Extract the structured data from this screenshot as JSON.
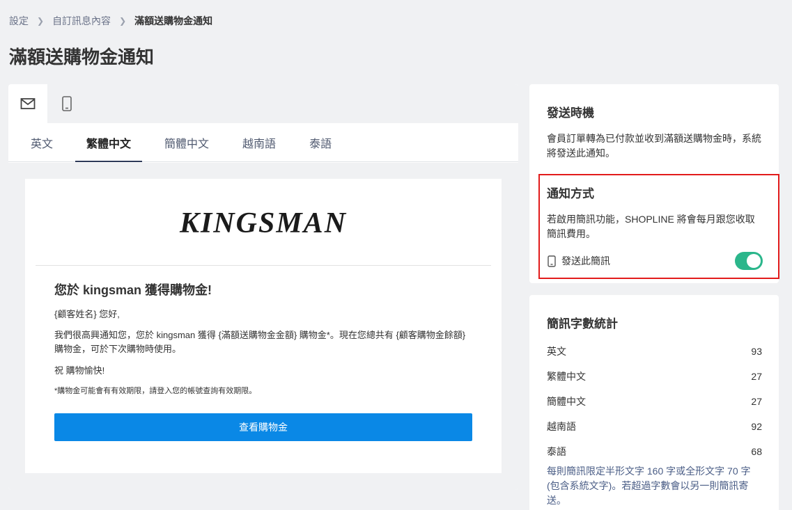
{
  "breadcrumb": {
    "items": [
      "設定",
      "自訂訊息內容",
      "滿額送購物金通知"
    ]
  },
  "page": {
    "title": "滿額送購物金通知"
  },
  "channels": {
    "email_icon": "mail-icon",
    "sms_icon": "mobile-icon"
  },
  "language_tabs": [
    "英文",
    "繁體中文",
    "簡體中文",
    "越南語",
    "泰語"
  ],
  "active_language": "繁體中文",
  "email": {
    "logo_text": "KINGSMAN",
    "heading": "您於 kingsman 獲得購物金!",
    "greeting": "{顧客姓名} 您好,",
    "paragraph": "我們很高興通知您，您於 kingsman 獲得 {滿額送購物金金額} 購物金*。現在您總共有 {顧客購物金餘額} 購物金，可於下次購物時使用。",
    "signoff": "祝 購物愉快!",
    "note": "*購物金可能會有有效期限，請登入您的帳號查詢有效期限。",
    "button_label": "查看購物金",
    "button_color": "#0a88e6"
  },
  "timing": {
    "title": "發送時機",
    "description": "會員訂單轉為已付款並收到滿額送購物金時，系統將發送此通知。"
  },
  "notification": {
    "title": "通知方式",
    "description": "若啟用簡訊功能，SHOPLINE 將會每月跟您收取簡訊費用。",
    "sms_label": "發送此簡訊",
    "sms_enabled": true,
    "toggle_color": "#2bb68b"
  },
  "sms_stats": {
    "title": "簡訊字數統計",
    "rows": [
      {
        "label": "英文",
        "value": "93"
      },
      {
        "label": "繁體中文",
        "value": "27"
      },
      {
        "label": "簡體中文",
        "value": "27"
      },
      {
        "label": "越南語",
        "value": "92"
      },
      {
        "label": "泰語",
        "value": "68"
      }
    ],
    "footnote": "每則簡訊限定半形文字 160 字或全形文字 70 字 (包含系統文字)。若超過字數會以另一則簡訊寄送。"
  }
}
